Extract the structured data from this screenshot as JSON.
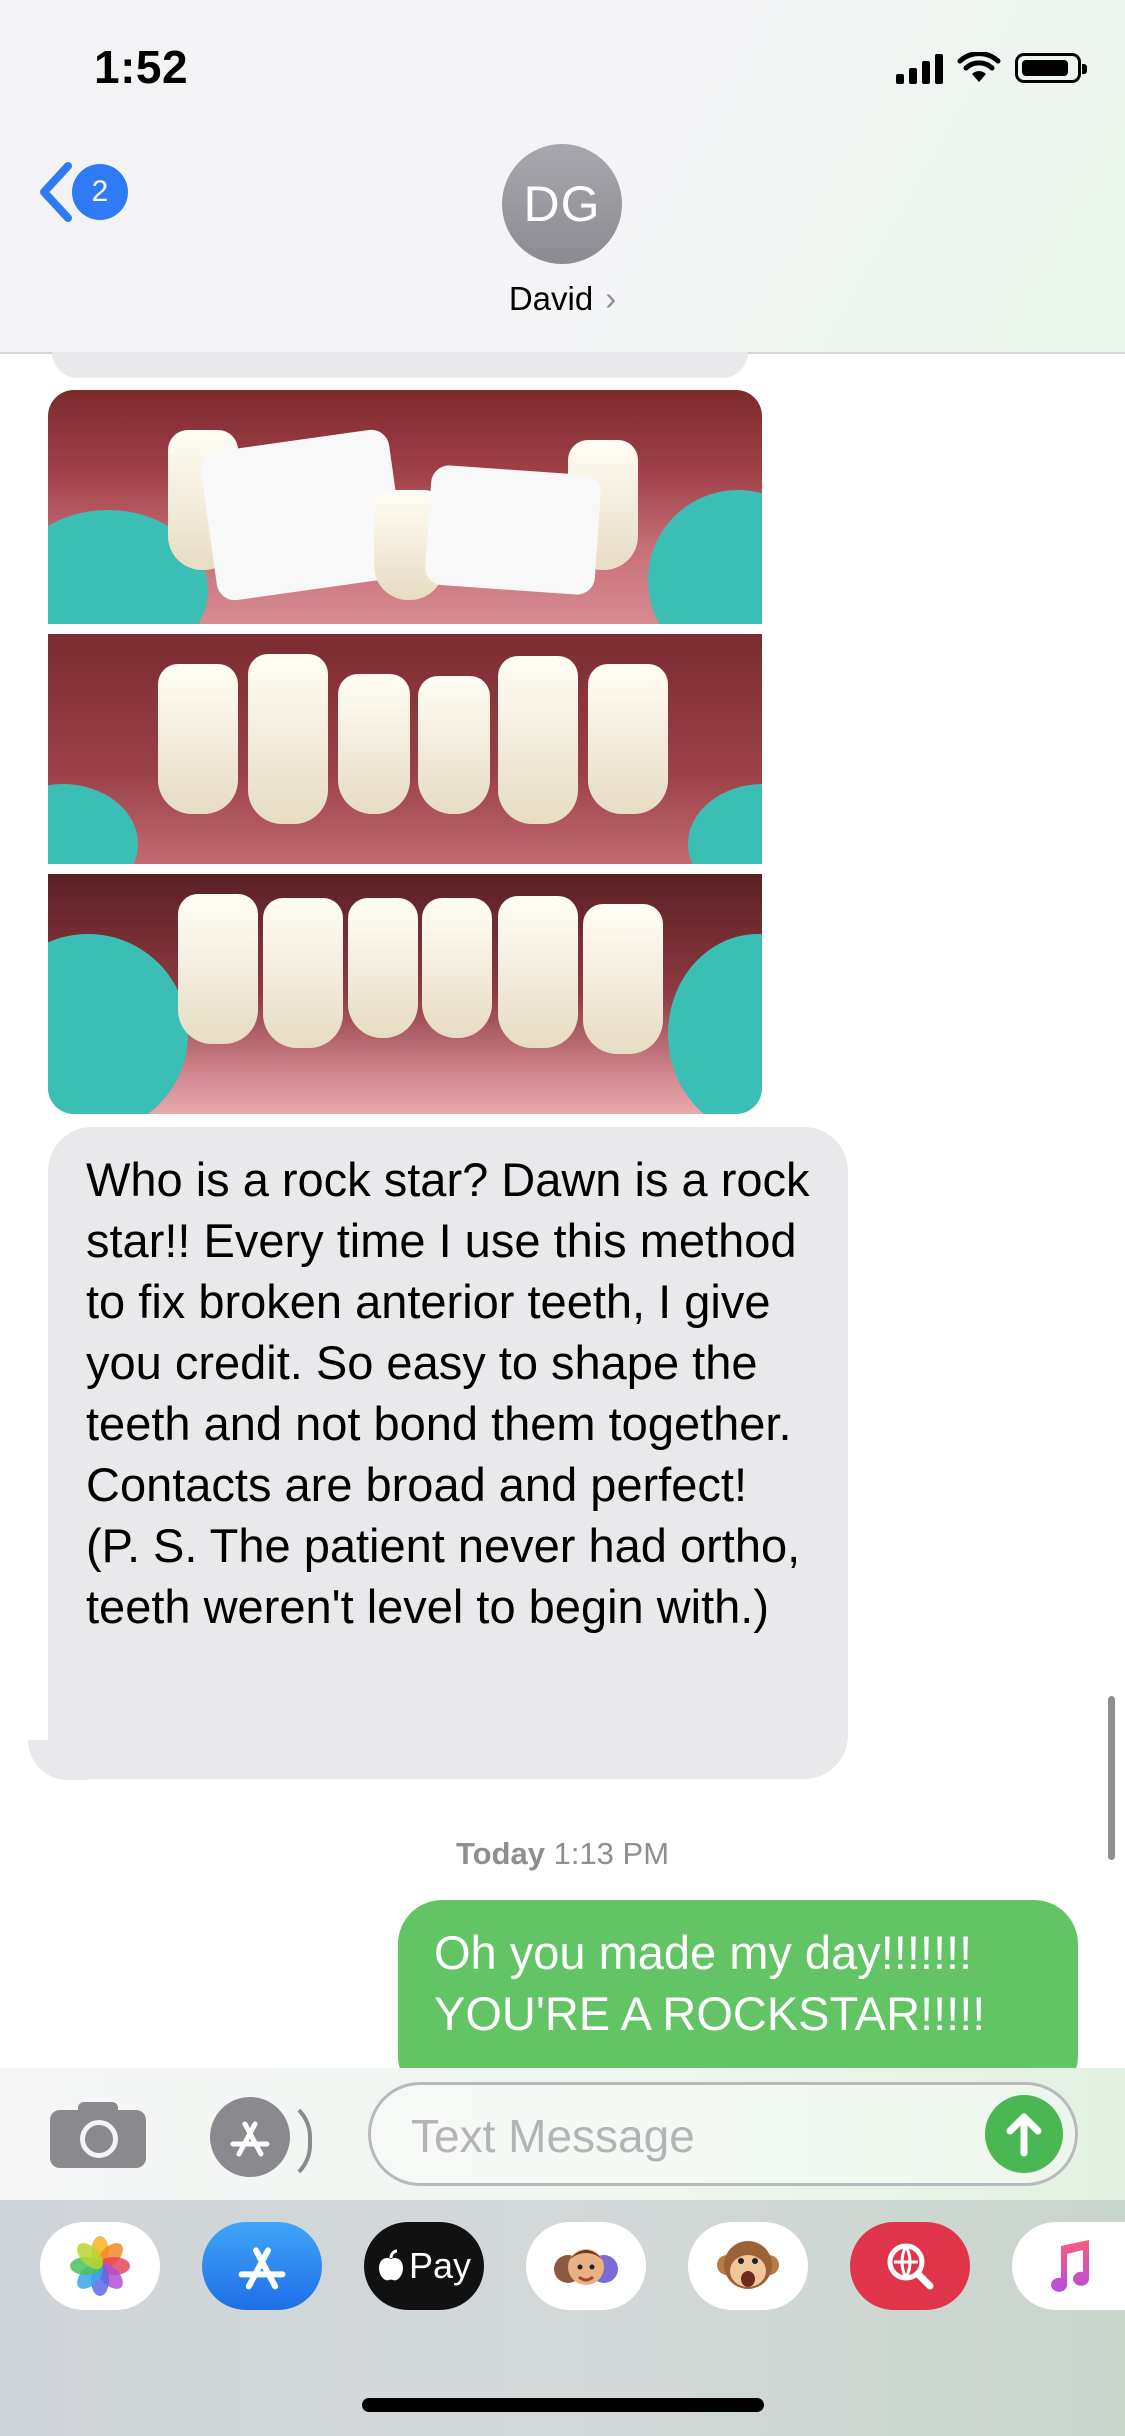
{
  "status_bar": {
    "time": "1:52"
  },
  "nav": {
    "back_count": "2",
    "contact_initials": "DG",
    "contact_name": "David",
    "contact_chevron": "›"
  },
  "messages": {
    "image_alt": "before and after photos of bonded lower front teeth",
    "incoming_text": "Who is a rock star?  Dawn is a rock star!! Every time I use this method to fix broken anterior teeth, I give you credit. So easy to shape the teeth and not bond them together. Contacts are broad and perfect! (P. S. The patient never had ortho, teeth weren't level to begin with.)",
    "timestamp_day": "Today",
    "timestamp_time": " 1:13 PM",
    "outgoing_text": "Oh you made my day!!!!!!! YOU'RE A ROCKSTAR!!!!!"
  },
  "compose": {
    "placeholder": "Text Message"
  },
  "app_drawer": {
    "items": [
      "photos-icon",
      "app-store-icon",
      "apple-pay-icon",
      "memoji-icon",
      "animoji-icon",
      "web-search-icon",
      "music-icon"
    ],
    "apple_pay_label": "Pay"
  },
  "colors": {
    "incoming_bubble": "#e9e9eb",
    "outgoing_bubble": "#63c466",
    "accent_blue": "#2f7bf5",
    "send_green": "#4bb752"
  }
}
